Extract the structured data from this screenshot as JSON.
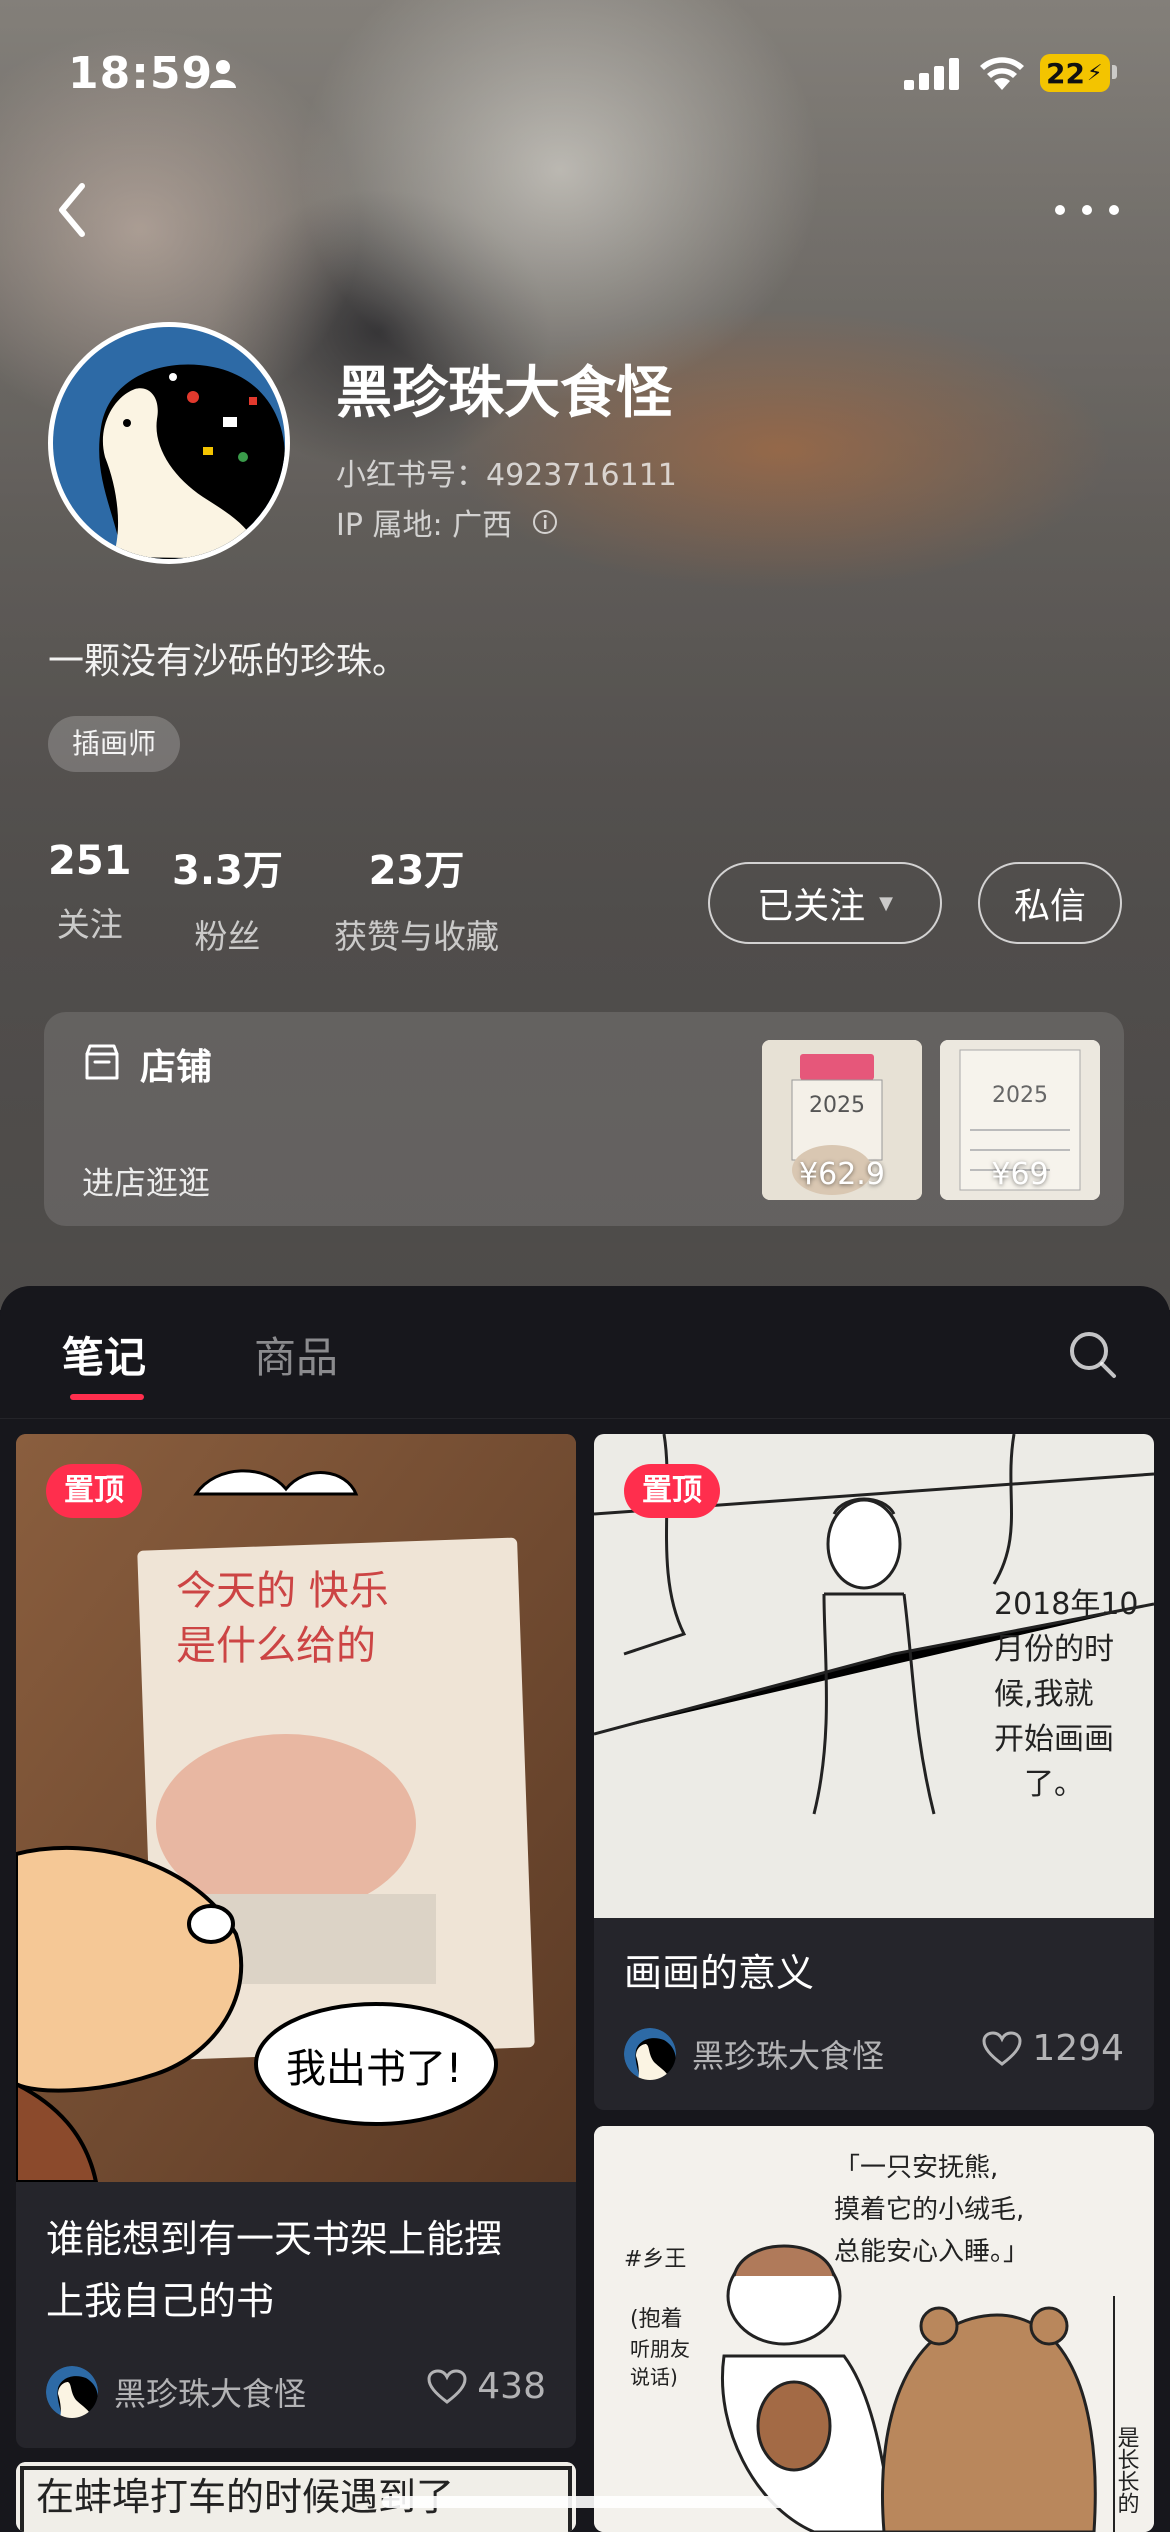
{
  "status_bar": {
    "time": "18:59",
    "battery": "22"
  },
  "profile": {
    "nickname": "黑珍珠大食怪",
    "redbook_id": "小红书号：4923716111",
    "ip": "IP 属地: 广西",
    "bio": "一颗没有沙砾的珍珠。",
    "tag": "插画师"
  },
  "stats": [
    {
      "value": "251",
      "label": "关注"
    },
    {
      "value": "3.3万",
      "label": "粉丝"
    },
    {
      "value": "23万",
      "label": "获赞与收藏"
    }
  ],
  "actions": {
    "follow_label": "已关注",
    "message_label": "私信"
  },
  "shop": {
    "title": "店铺",
    "subtitle": "进店逛逛",
    "items": [
      {
        "price": "¥62.9",
        "cover_text": "2025"
      },
      {
        "price": "¥69",
        "cover_text": "2025"
      }
    ]
  },
  "tabs": [
    {
      "label": "笔记",
      "active": true
    },
    {
      "label": "商品",
      "active": false
    }
  ],
  "notes": [
    {
      "pinned_label": "置顶",
      "image_text": [
        "今天的 快乐",
        "是什么给的",
        "我出书了!"
      ],
      "title_lines": [
        "谁能想到有一天书架上能摆",
        "上我自己的书"
      ],
      "author": "黑珍珠大食怪",
      "likes": "438"
    },
    {
      "pinned_label": "置顶",
      "image_text": [
        "2018年10",
        "月份的时",
        "候,我就",
        "开始画画",
        "了。"
      ],
      "title_lines": [
        "画画的意义"
      ],
      "author": "黑珍珠大食怪",
      "likes": "1294"
    },
    {
      "image_text": [
        "「一只安抚熊,",
        "摸着它的小绒毛,",
        "总能安心入睡。」",
        "#乡王",
        "(抱着",
        "听朋友",
        "说话)",
        "是长长的"
      ]
    },
    {
      "image_text": [
        "在蚌埠打车的时候遇到了"
      ]
    }
  ],
  "colors": {
    "accent": "#ff2e4d",
    "background": "#17171c",
    "card": "#25252b"
  }
}
